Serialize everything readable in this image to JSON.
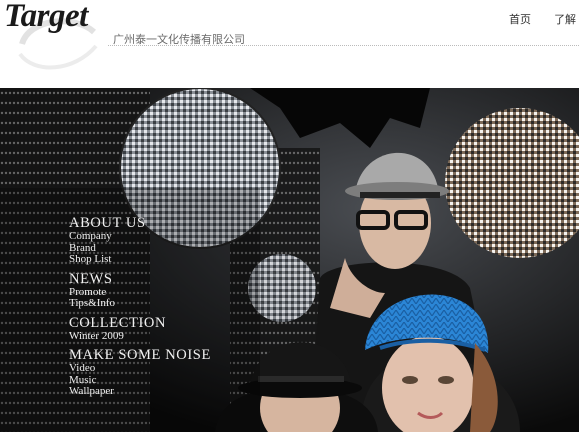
{
  "brand": {
    "logo_text": "Target",
    "company_name": "广州泰一文化传播有限公司"
  },
  "nav": {
    "items": [
      "首页",
      "了解"
    ]
  },
  "menu": {
    "sections": [
      {
        "title": "ABOUT US",
        "items": [
          "Company",
          "Brand",
          "Shop List"
        ]
      },
      {
        "title": "NEWS",
        "items": [
          "Promote",
          "Tips&Info"
        ]
      },
      {
        "title": "COLLECTION",
        "items": [
          "Winter 2009"
        ]
      },
      {
        "title": "MAKE SOME NOISE",
        "items": [
          "Video",
          "Music",
          "Wallpaper"
        ]
      }
    ]
  }
}
